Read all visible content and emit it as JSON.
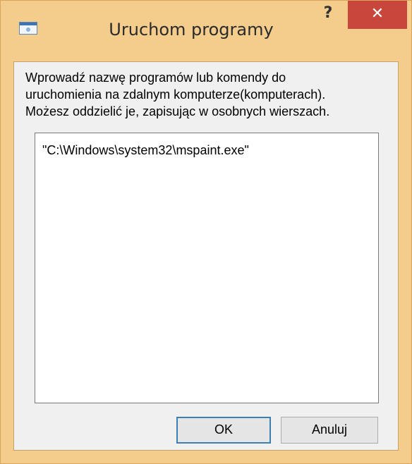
{
  "window": {
    "title": "Uruchom programy",
    "help_label": "?",
    "close_label": "✕",
    "colors": {
      "frame": "#f4cc8c",
      "close": "#c8463b",
      "client": "#f0f0f0",
      "accent_border": "#3c7fb1"
    }
  },
  "instruction": {
    "lines": [
      "Wprowadź nazwę programów lub komendy do",
      "uruchomienia na zdalnym komputerze(komputerach).",
      "Możesz oddzielić je, zapisując w osobnych wierszach."
    ]
  },
  "programs": {
    "value": "\"C:\\Windows\\system32\\mspaint.exe\""
  },
  "buttons": {
    "ok_label": "OK",
    "cancel_label": "Anuluj"
  },
  "icons": {
    "app": "window-app-icon",
    "help": "help-icon",
    "close": "close-icon"
  }
}
